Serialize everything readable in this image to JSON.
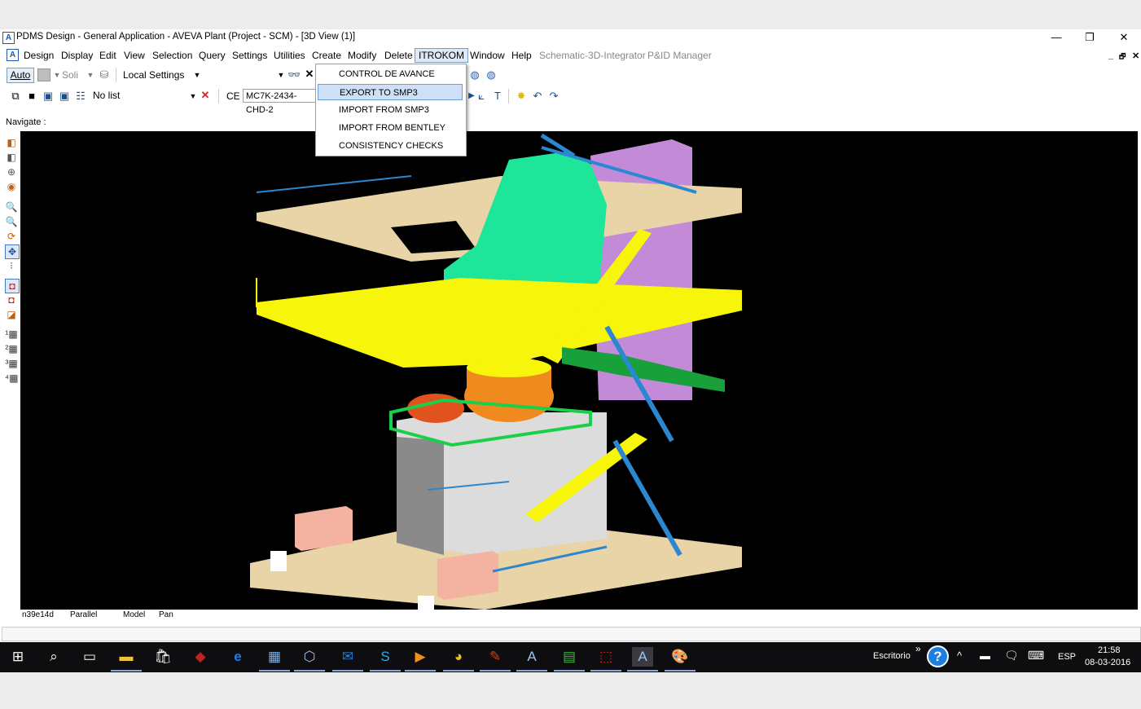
{
  "window": {
    "title": "PDMS Design - General Application -  AVEVA Plant (Project - SCM) - [3D View (1)]",
    "app_icon": "aveva-icon",
    "controls": {
      "minimize": "—",
      "restore": "❐",
      "close": "✕"
    }
  },
  "menubar": {
    "items": [
      {
        "label": "Design"
      },
      {
        "label": "Display"
      },
      {
        "label": "Edit"
      },
      {
        "label": "View"
      },
      {
        "label": "Selection"
      },
      {
        "label": "Query"
      },
      {
        "label": "Settings"
      },
      {
        "label": "Utilities"
      },
      {
        "label": "Create"
      },
      {
        "label": "Modify"
      },
      {
        "label": "Delete"
      },
      {
        "label": "ITROKOM"
      },
      {
        "label": "Window"
      },
      {
        "label": "Help"
      },
      {
        "label": "Schematic-3D-Integrator"
      },
      {
        "label": "P&ID Manager"
      }
    ],
    "mdi": {
      "minimize": "_",
      "restore": "🗗",
      "close": "✕"
    }
  },
  "toolbar1": {
    "auto_label": "Auto",
    "solid_label": "Soli",
    "settings_value": "Local Settings"
  },
  "toolbar2": {
    "list_value": "No list",
    "ce_label": "CE",
    "ce_value": "MC7K-2434-CHD-2"
  },
  "dropdown": {
    "items": [
      {
        "label": "CONTROL DE AVANCE"
      },
      {
        "label": "EXPORT TO SMP3",
        "highlighted": true
      },
      {
        "label": "IMPORT FROM SMP3"
      },
      {
        "label": "IMPORT FROM BENTLEY"
      },
      {
        "label": "CONSISTENCY CHECKS"
      }
    ]
  },
  "navigate_label": "Navigate :",
  "statusbar": {
    "element": "n39e14d",
    "projection": "Parallel",
    "mode": "Model",
    "action": "Pan"
  },
  "taskbar": {
    "icons": [
      "windows-start-icon",
      "search-icon",
      "task-view-icon",
      "file-explorer-icon",
      "store-icon",
      "app-red-icon",
      "edge-icon",
      "calculator-icon",
      "virtualbox-icon",
      "outlook-icon",
      "skype-icon",
      "media-player-icon",
      "chrome-icon",
      "notepad-icon",
      "aveva-icon",
      "spreadsheet-icon",
      "pdf-icon",
      "aveva-active-icon",
      "paint-icon"
    ],
    "desktop_label": "Escritorio",
    "expand_label": "»",
    "help_label": "?",
    "language": "ESP",
    "time": "21:58",
    "date": "08-03-2016"
  },
  "colors": {
    "viewport_bg": "#000000",
    "highlight": "#cde0f7",
    "structure_yellow": "#f6f50a",
    "equipment_green": "#1de59a",
    "concrete_tan": "#e9d4a7",
    "purple": "#c38ad8",
    "blue_steel": "#2b88d0",
    "orange_equipment": "#f08a1e"
  }
}
